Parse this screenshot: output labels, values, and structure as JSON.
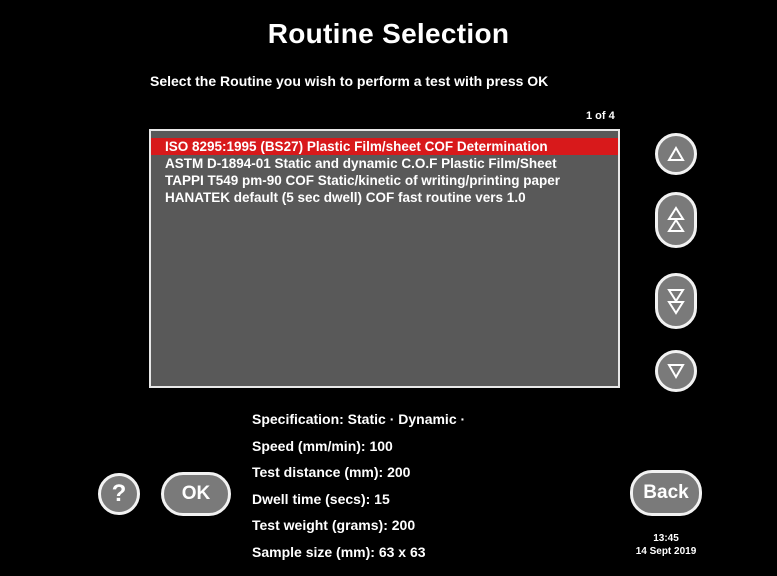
{
  "header": {
    "title": "Routine Selection",
    "instruction": "Select the Routine you wish to perform a test with press OK"
  },
  "list": {
    "page_indicator": "1 of 4",
    "items": [
      {
        "label": "ISO 8295:1995 (BS27) Plastic Film/sheet COF Determination",
        "selected": true
      },
      {
        "label": "ASTM D-1894-01 Static and dynamic C.O.F Plastic Film/Sheet",
        "selected": false
      },
      {
        "label": "TAPPI T549 pm-90 COF Static/kinetic of writing/printing paper",
        "selected": false
      },
      {
        "label": "HANATEK default (5 sec dwell) COF fast routine vers 1.0",
        "selected": false
      }
    ]
  },
  "nav": {
    "up_icon": "triangle-up-icon",
    "page_up_icon": "double-triangle-up-icon",
    "page_down_icon": "double-triangle-down-icon",
    "down_icon": "triangle-down-icon"
  },
  "details": {
    "specification": "Specification: Static · Dynamic ·",
    "speed": "Speed (mm/min): 100",
    "test_distance": "Test distance (mm): 200",
    "dwell_time": "Dwell time (secs): 15",
    "test_weight": "Test weight (grams): 200",
    "sample_size": "Sample size (mm): 63 x 63"
  },
  "buttons": {
    "help_label": "?",
    "ok_label": "OK",
    "back_label": "Back"
  },
  "clock": {
    "time": "13:45",
    "date": "14 Sept 2019"
  },
  "colors": {
    "background": "#000000",
    "list_background": "#595959",
    "selection": "#d8191b",
    "button_fill": "#7a7a7a",
    "button_border": "#f2f2f2"
  }
}
